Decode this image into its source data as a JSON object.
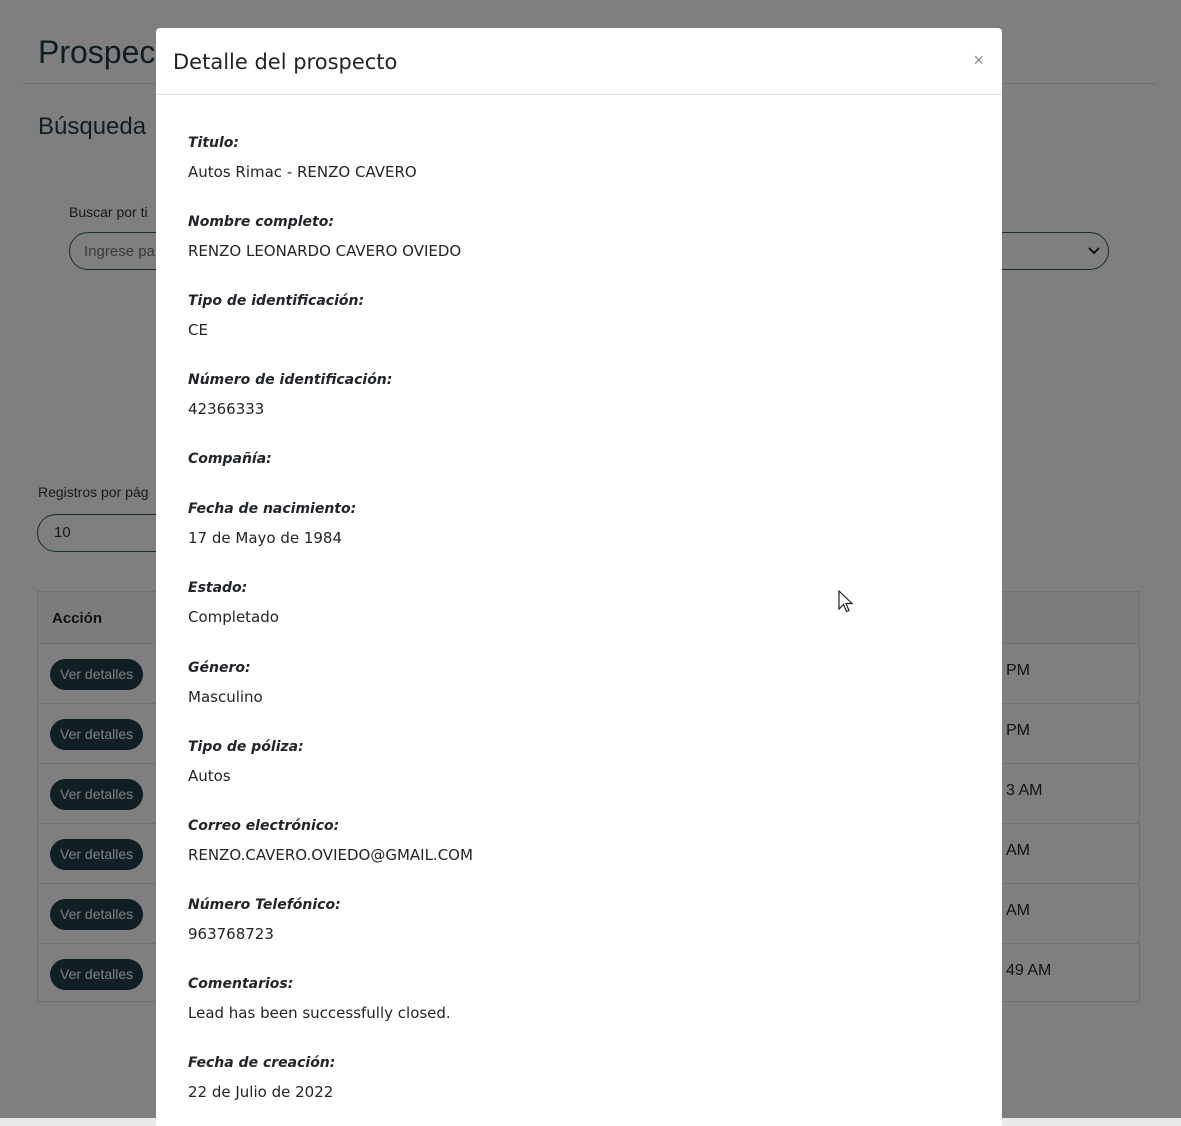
{
  "background": {
    "page_title": "Prospec",
    "section_title": "Búsqueda",
    "search_label": "Buscar por ti",
    "search_placeholder": "Ingrese pa",
    "perpage_label": "Registros por pág",
    "perpage_value": "10",
    "table_header_action": "Acción",
    "rows": [
      {
        "button": "Ver detalles",
        "time": "PM"
      },
      {
        "button": "Ver detalles",
        "time": "PM"
      },
      {
        "button": "Ver detalles",
        "time": "3 AM"
      },
      {
        "button": "Ver detalles",
        "time": "AM"
      },
      {
        "button": "Ver detalles",
        "time": "AM"
      },
      {
        "button": "Ver detalles",
        "time": "49 AM"
      }
    ]
  },
  "modal": {
    "title": "Detalle del prospecto",
    "close_glyph": "×",
    "fields": [
      {
        "label": "Titulo:",
        "value": "Autos Rimac - RENZO CAVERO"
      },
      {
        "label": "Nombre completo:",
        "value": "RENZO LEONARDO CAVERO OVIEDO"
      },
      {
        "label": "Tipo de identificación:",
        "value": "CE"
      },
      {
        "label": "Número de identificación:",
        "value": "42366333"
      },
      {
        "label": "Compañía:",
        "value": ""
      },
      {
        "label": "Fecha de nacimiento:",
        "value": "17 de Mayo de 1984"
      },
      {
        "label": "Estado:",
        "value": "Completado"
      },
      {
        "label": "Género:",
        "value": "Masculino"
      },
      {
        "label": "Tipo de póliza:",
        "value": "Autos"
      },
      {
        "label": "Correo electrónico:",
        "value": "RENZO.CAVERO.OVIEDO@GMAIL.COM"
      },
      {
        "label": "Número Telefónico:",
        "value": "963768723"
      },
      {
        "label": "Comentarios:",
        "value": "Lead has been successfully closed."
      },
      {
        "label": "Fecha de creación:",
        "value": "22 de Julio de 2022"
      }
    ]
  },
  "colors": {
    "accent": "#1e3f48",
    "input_border": "#2e5b64",
    "backdrop": "rgba(0,0,0,0.5)"
  }
}
